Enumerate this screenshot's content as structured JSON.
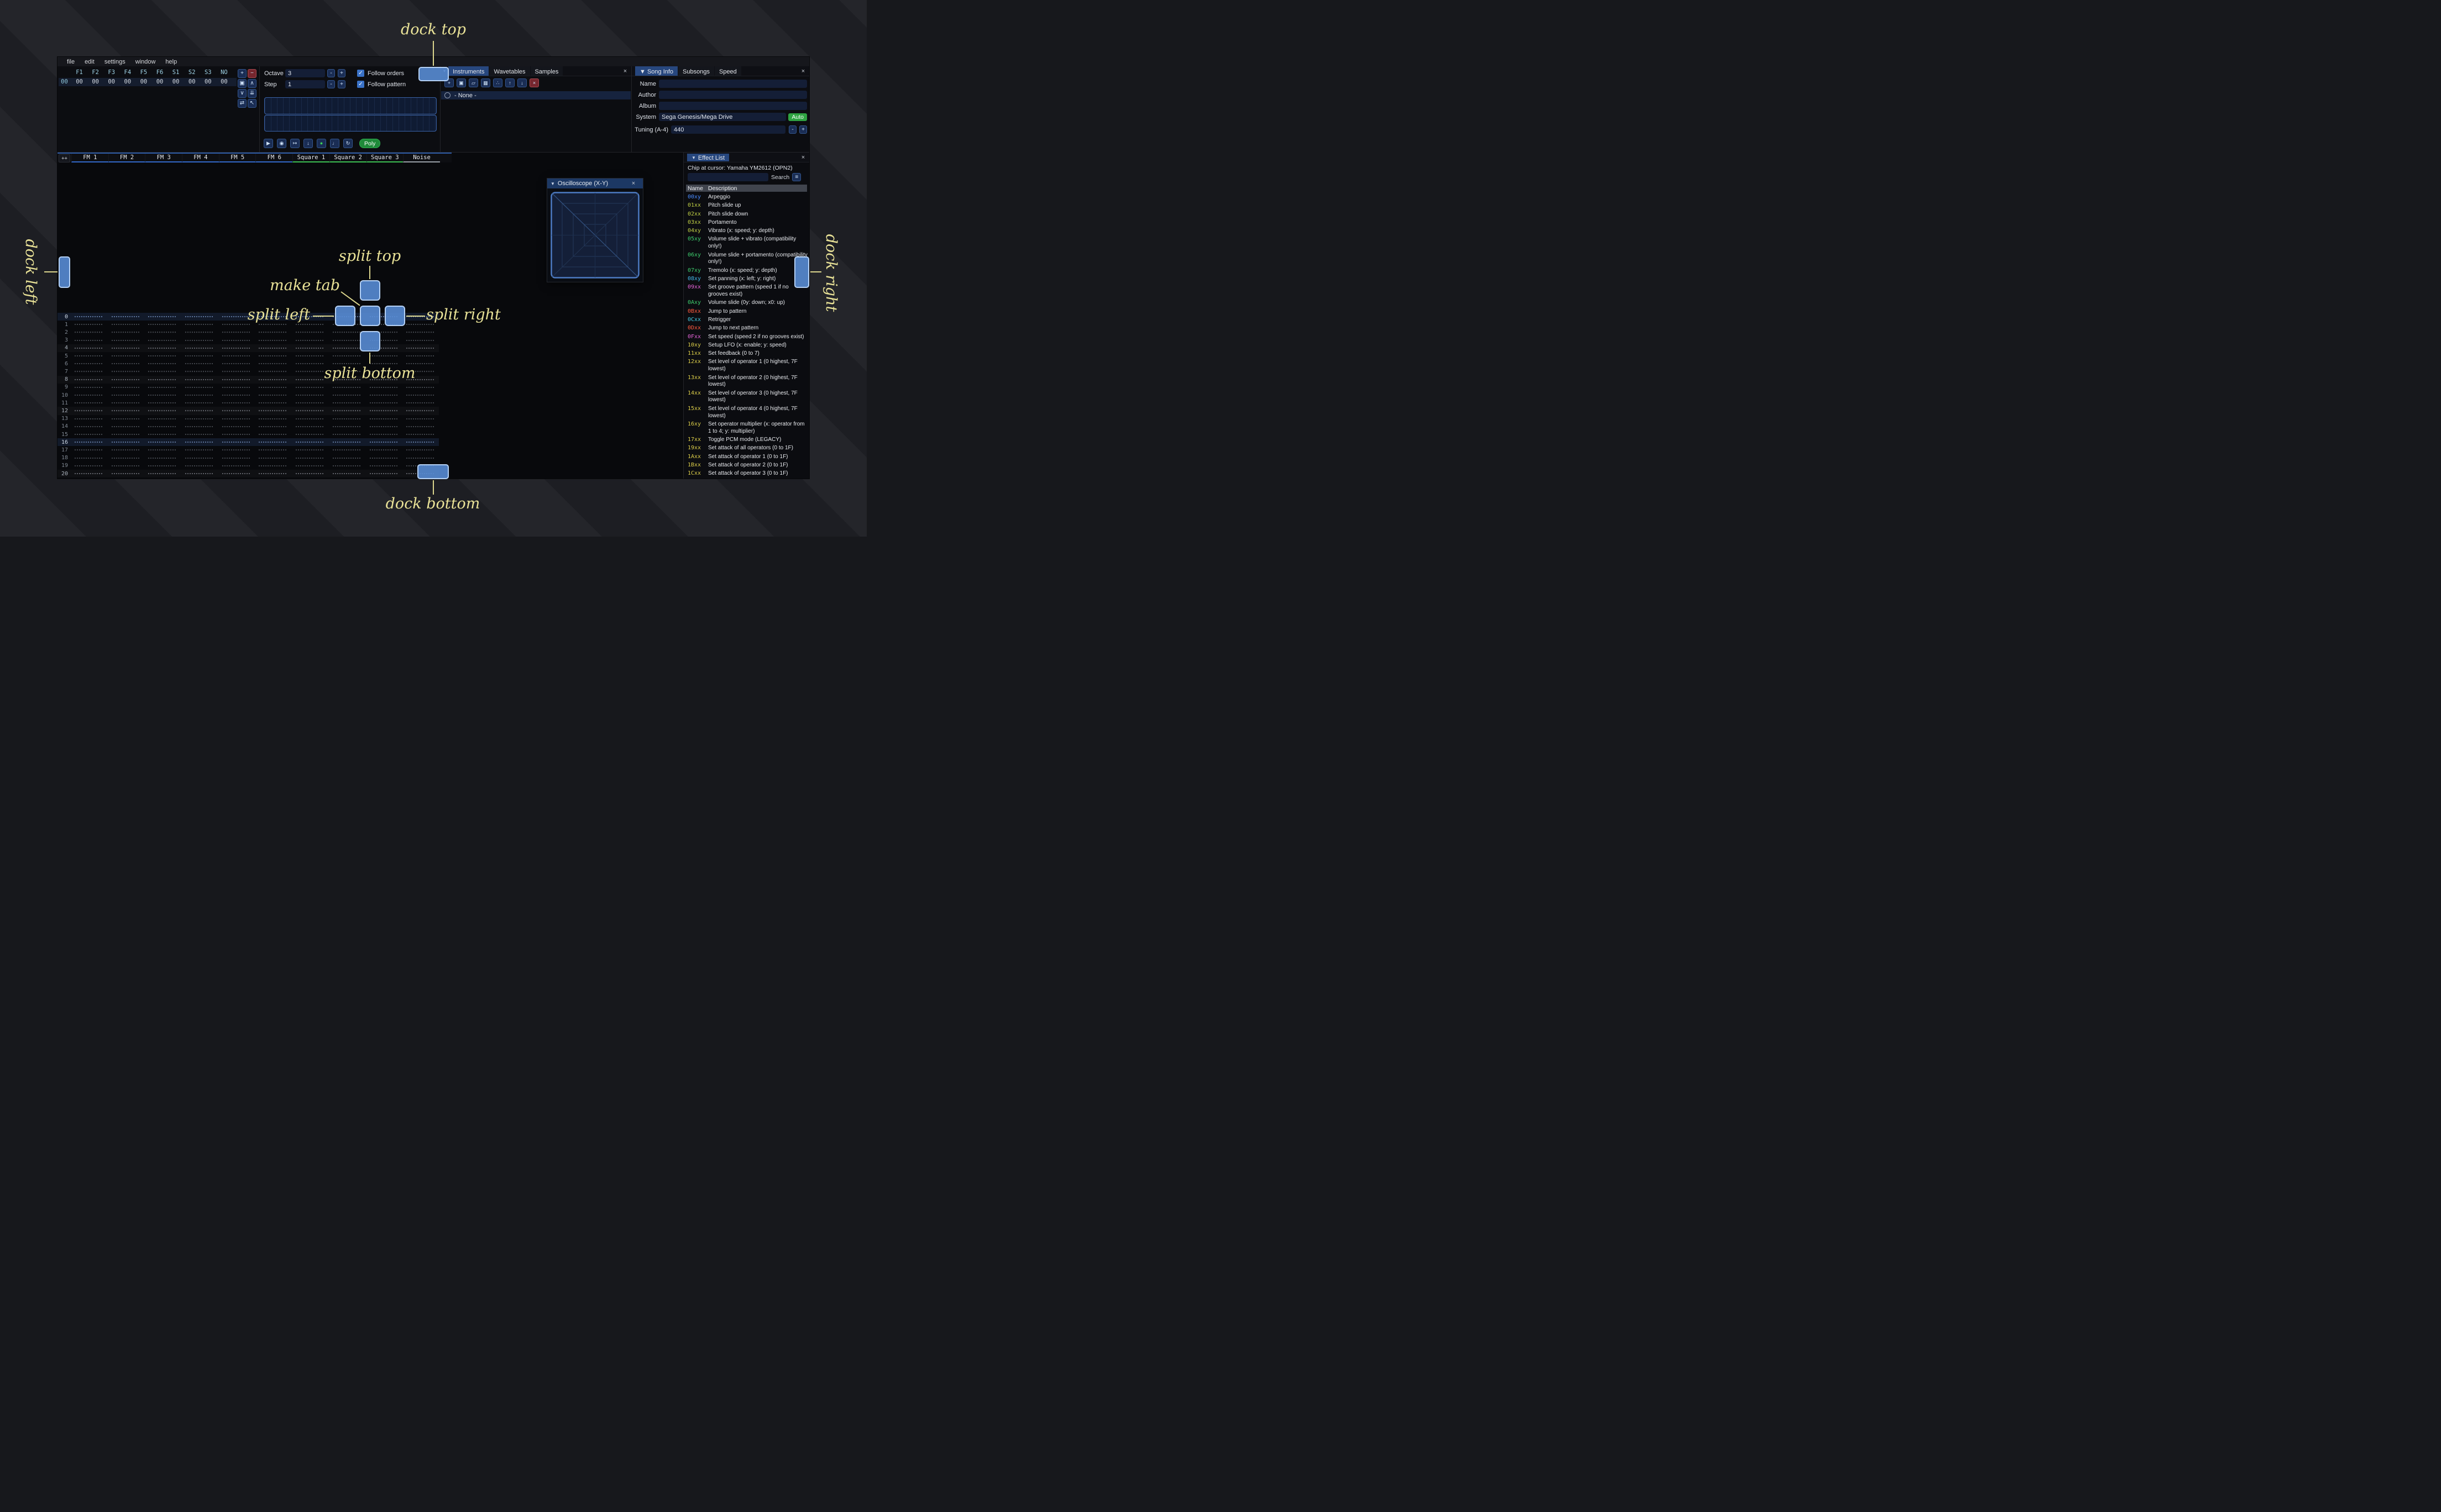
{
  "menu": [
    "file",
    "edit",
    "settings",
    "window",
    "help"
  ],
  "annotations": {
    "dock_top": "dock top",
    "dock_bottom": "dock bottom",
    "dock_left": "dock left",
    "dock_right": "dock right",
    "split_top": "split top",
    "split_bottom": "split bottom",
    "split_left": "split left",
    "split_right": "split right",
    "make_tab": "make tab",
    "color": "#e9e297"
  },
  "order_list": {
    "headers": [
      "F1",
      "F2",
      "F3",
      "F4",
      "F5",
      "F6",
      "S1",
      "S2",
      "S3",
      "NO"
    ],
    "row_index": "00",
    "row_values": [
      "00",
      "00",
      "00",
      "00",
      "00",
      "00",
      "00",
      "00",
      "00",
      "00"
    ],
    "buttons": [
      {
        "name": "add-order",
        "glyph": "+"
      },
      {
        "name": "remove-order",
        "glyph": "−",
        "color": "red"
      },
      {
        "name": "duplicate-order",
        "glyph": "▣"
      },
      {
        "name": "move-order-up",
        "glyph": "∧"
      },
      {
        "name": "move-order-down",
        "glyph": "∨"
      },
      {
        "name": "duplicate-order-to-end",
        "glyph": "⇊"
      },
      {
        "name": "order-change-mode",
        "glyph": "⇄"
      },
      {
        "name": "order-edit-mode",
        "glyph": "↖"
      }
    ]
  },
  "controls": {
    "octave_label": "Octave",
    "octave_value": "3",
    "step_label": "Step",
    "step_value": "1",
    "minus": "-",
    "plus": "+",
    "check_glyph": "✓",
    "follow_orders": "Follow orders",
    "follow_pattern": "Follow pattern",
    "transport": [
      {
        "name": "play",
        "glyph": "▶"
      },
      {
        "name": "play-from-cursor",
        "glyph": "◉"
      },
      {
        "name": "play-one-row",
        "glyph": "↦"
      },
      {
        "name": "move-cursor-down",
        "glyph": "↓"
      },
      {
        "name": "edit-record-toggle",
        "glyph": "●"
      },
      {
        "name": "metronome",
        "glyph": "♩"
      },
      {
        "name": "repeat-pattern",
        "glyph": "↻"
      }
    ],
    "poly_label": "Poly"
  },
  "instruments_panel": {
    "tab_arrow": "▾",
    "tabs": [
      "Instruments",
      "Wavetables",
      "Samples"
    ],
    "active_tab": 0,
    "close": "×",
    "toolbar": [
      {
        "name": "add-instrument",
        "glyph": "+"
      },
      {
        "name": "duplicate-instrument",
        "glyph": "▣"
      },
      {
        "name": "open-instrument",
        "glyph": "▱"
      },
      {
        "name": "save-instrument",
        "glyph": "▦"
      },
      {
        "name": "instrument-folders",
        "glyph": "∴"
      },
      {
        "name": "move-instrument-up",
        "glyph": "↑"
      },
      {
        "name": "move-instrument-down",
        "glyph": "↓"
      },
      {
        "name": "delete-instrument",
        "glyph": "×",
        "color": "red"
      }
    ],
    "list": [
      {
        "label": "- None -",
        "selected": true
      }
    ]
  },
  "song_info": {
    "collapse_arrow": "▼",
    "tabs": [
      "Song Info",
      "Subsongs",
      "Speed"
    ],
    "active_tab": 0,
    "close": "×",
    "fields": [
      {
        "label": "Name",
        "value": ""
      },
      {
        "label": "Author",
        "value": ""
      },
      {
        "label": "Album",
        "value": ""
      }
    ],
    "system_label": "System",
    "system_value": "Sega Genesis/Mega Drive",
    "auto_label": "Auto",
    "tuning_label": "Tuning (A-4)",
    "tuning_value": "440",
    "minus": "-",
    "plus": "+"
  },
  "pattern": {
    "corner_button": "++",
    "row_count": 22,
    "first_row": 0,
    "channels": [
      {
        "name": "FM 1",
        "color": "#3268c8"
      },
      {
        "name": "FM 2",
        "color": "#3268c8"
      },
      {
        "name": "FM 3",
        "color": "#3268c8"
      },
      {
        "name": "FM 4",
        "color": "#3268c8"
      },
      {
        "name": "FM 5",
        "color": "#3268c8"
      },
      {
        "name": "FM 6",
        "color": "#3268c8"
      },
      {
        "name": "Square 1",
        "color": "#3cbf52"
      },
      {
        "name": "Square 2",
        "color": "#3cbf52"
      },
      {
        "name": "Square 3",
        "color": "#3cbf52"
      },
      {
        "name": "Noise",
        "color": "#9aa0a8"
      }
    ]
  },
  "effect_list": {
    "collapse_arrow": "▼",
    "title": "Effect List",
    "close": "×",
    "chip_line": "Chip at cursor: Yamaha YM2612 (OPN2)",
    "search_value": "",
    "search_label": "Search",
    "menu_icon": "≡",
    "columns": [
      "Name",
      "Description"
    ],
    "effects": [
      {
        "code": "00xy",
        "color": "#4a8cff",
        "desc": "Arpeggio"
      },
      {
        "code": "01xx",
        "color": "#c0d045",
        "desc": "Pitch slide up"
      },
      {
        "code": "02xx",
        "color": "#c0d045",
        "desc": "Pitch slide down"
      },
      {
        "code": "03xx",
        "color": "#c0d045",
        "desc": "Portamento"
      },
      {
        "code": "04xy",
        "color": "#c0d045",
        "desc": "Vibrato (x: speed; y: depth)"
      },
      {
        "code": "05xy",
        "color": "#3ecf6e",
        "desc": "Volume slide + vibrato (compatibility only!)"
      },
      {
        "code": "06xy",
        "color": "#3ecf6e",
        "desc": "Volume slide + portamento (compatibility only!)"
      },
      {
        "code": "07xy",
        "color": "#3ecf6e",
        "desc": "Tremolo (x: speed; y: depth)"
      },
      {
        "code": "08xy",
        "color": "#42b8e8",
        "desc": "Set panning (x: left; y: right)"
      },
      {
        "code": "09xx",
        "color": "#e464d8",
        "desc": "Set groove pattern (speed 1 if no grooves exist)"
      },
      {
        "code": "0Axy",
        "color": "#3ecf6e",
        "desc": "Volume slide (0y: down; x0: up)"
      },
      {
        "code": "0Bxx",
        "color": "#ff5a40",
        "desc": "Jump to pattern"
      },
      {
        "code": "0Cxx",
        "color": "#42c8e0",
        "desc": "Retrigger"
      },
      {
        "code": "0Dxx",
        "color": "#ff5a40",
        "desc": "Jump to next pattern"
      },
      {
        "code": "0Fxx",
        "color": "#e464d8",
        "desc": "Set speed (speed 2 if no grooves exist)"
      },
      {
        "code": "10xy",
        "color": "#ddcf4a",
        "desc": "Setup LFO (x: enable; y: speed)"
      },
      {
        "code": "11xx",
        "color": "#ddcf4a",
        "desc": "Set feedback (0 to 7)"
      },
      {
        "code": "12xx",
        "color": "#ddcf4a",
        "desc": "Set level of operator 1 (0 highest, 7F lowest)"
      },
      {
        "code": "13xx",
        "color": "#ddcf4a",
        "desc": "Set level of operator 2 (0 highest, 7F lowest)"
      },
      {
        "code": "14xx",
        "color": "#ddcf4a",
        "desc": "Set level of operator 3 (0 highest, 7F lowest)"
      },
      {
        "code": "15xx",
        "color": "#ddcf4a",
        "desc": "Set level of operator 4 (0 highest, 7F lowest)"
      },
      {
        "code": "16xy",
        "color": "#ddcf4a",
        "desc": "Set operator multiplier (x: operator from 1 to 4; y: multiplier)"
      },
      {
        "code": "17xx",
        "color": "#ddcf4a",
        "desc": "Toggle PCM mode (LEGACY)"
      },
      {
        "code": "19xx",
        "color": "#ddcf4a",
        "desc": "Set attack of all operators (0 to 1F)"
      },
      {
        "code": "1Axx",
        "color": "#ddcf4a",
        "desc": "Set attack of operator 1 (0 to 1F)"
      },
      {
        "code": "1Bxx",
        "color": "#ddcf4a",
        "desc": "Set attack of operator 2 (0 to 1F)"
      },
      {
        "code": "1Cxx",
        "color": "#ddcf4a",
        "desc": "Set attack of operator 3 (0 to 1F)"
      }
    ]
  },
  "oscilloscope": {
    "collapse_arrow": "▼",
    "title": "Oscilloscope (X-Y)",
    "close": "×"
  },
  "colors": {
    "dock_target": "#588cd4",
    "accent_blue": "#27477e",
    "record_green": "#3fd158",
    "poly_green": "#1f8a3a",
    "auto_green": "#2fa342",
    "remove_red": "#76262e"
  }
}
